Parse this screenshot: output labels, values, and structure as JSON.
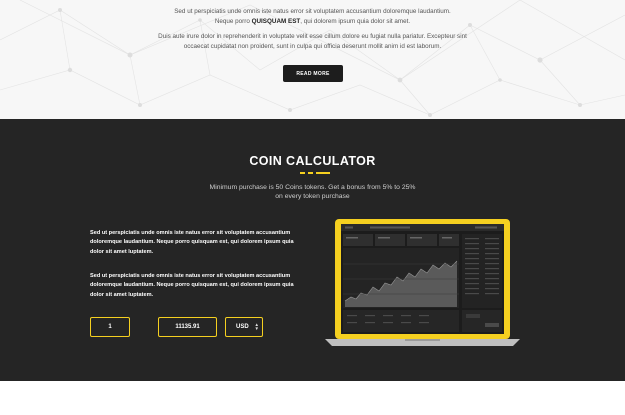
{
  "intro": {
    "line1": "Sed ut perspiciatis unde omnis iste natus error sit voluptatem accusantium doloremque laudantium.",
    "line2_pre": "Neque porro ",
    "line2_bold": "QUISQUAM EST",
    "line2_post": ", qui dolorem ipsum quia dolor sit amet.",
    "line3": "Duis aute irure dolor in reprehenderit in voluptate velit esse cillum dolore eu fugiat nulla pariatur. Excepteur sint",
    "line4": "occaecat cupidatat non proident, sunt in culpa qui officia deserunt mollit anim id est laborum.",
    "read_more_label": "READ MORE"
  },
  "calculator": {
    "title": "COIN CALCULATOR",
    "subtitle_line1": "Minimum purchase is 50 Coins tokens. Get a bonus from 5% to 25%",
    "subtitle_line2": "on every token purchase",
    "paragraph1": "Sed ut perspiciatis unde omnis iste natus error sit voluptatem accusantium doloremque laudantium. Neque porro quisquam est, qui dolorem ipsum quia dolor sit amet luptatem.",
    "paragraph2": "Sed ut perspiciatis unde omnis iste natus error sit voluptatem accusantium doloremque laudantium. Neque porro quisquam est, qui dolorem ipsum quia dolor sit amet luptatem.",
    "amount_value": "1",
    "total_value": "11135.91",
    "currency_value": "USD",
    "accent_color": "#f5d020",
    "background_color": "#252525"
  },
  "icons": {
    "currency_caret": "updown-caret-icon",
    "laptop": "laptop-dashboard-icon"
  }
}
